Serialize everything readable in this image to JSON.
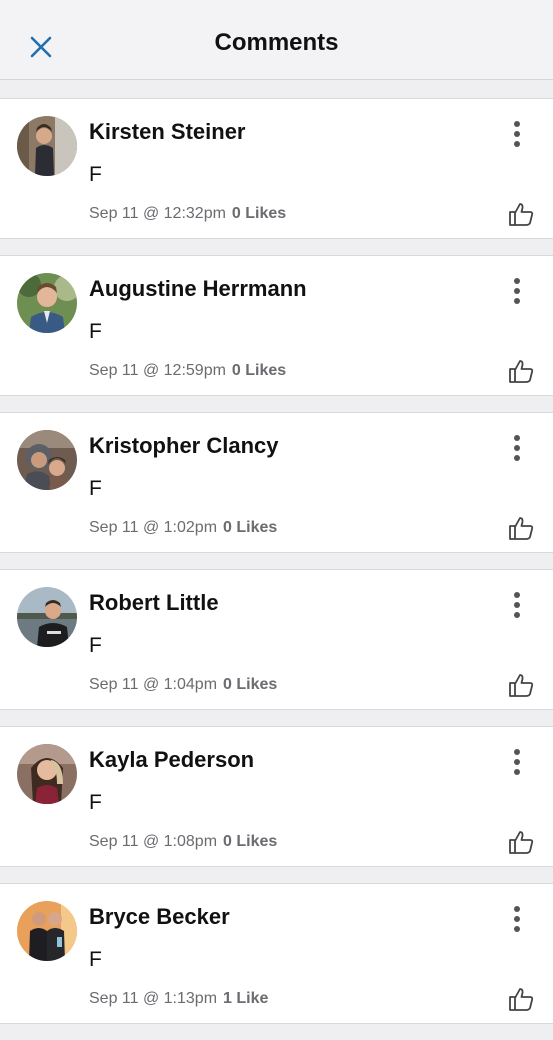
{
  "header": {
    "title": "Comments",
    "close_icon": "close-icon",
    "accent": "#1f6fb2"
  },
  "comments": [
    {
      "name": "Kirsten Steiner",
      "text": "F",
      "time": "Sep 11 @ 12:32pm",
      "likes": "0 Likes"
    },
    {
      "name": "Augustine Herrmann",
      "text": "F",
      "time": "Sep 11 @ 12:59pm",
      "likes": "0 Likes"
    },
    {
      "name": "Kristopher Clancy",
      "text": "F",
      "time": "Sep 11 @ 1:02pm",
      "likes": "0 Likes"
    },
    {
      "name": "Robert Little",
      "text": "F",
      "time": "Sep 11 @ 1:04pm",
      "likes": "0 Likes"
    },
    {
      "name": "Kayla Pederson",
      "text": "F",
      "time": "Sep 11 @ 1:08pm",
      "likes": "0 Likes"
    },
    {
      "name": "Bryce Becker",
      "text": "F",
      "time": "Sep 11 @ 1:13pm",
      "likes": "1 Like"
    }
  ]
}
